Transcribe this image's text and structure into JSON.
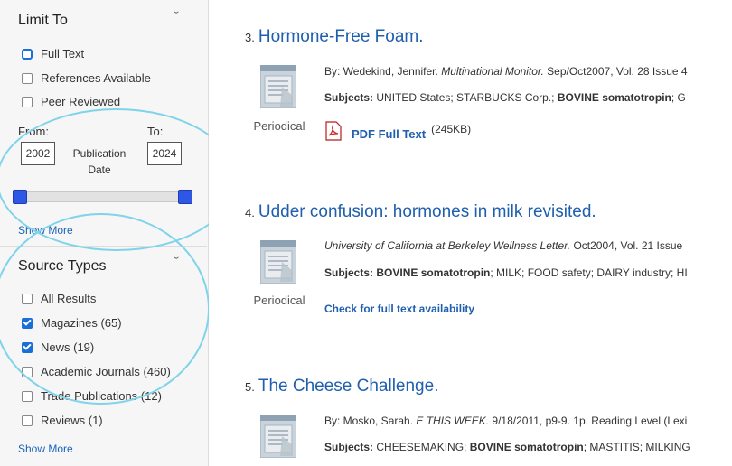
{
  "sidebar": {
    "limit_to": {
      "title": "Limit To",
      "options": [
        {
          "label": "Full Text",
          "checked": false
        },
        {
          "label": "References Available",
          "checked": false
        },
        {
          "label": "Peer Reviewed",
          "checked": false
        }
      ],
      "from_label": "From:",
      "to_label": "To:",
      "from_year": "2002",
      "to_year": "2024",
      "pub_date_label": "Publication Date",
      "show_more": "Show More"
    },
    "source_types": {
      "title": "Source Types",
      "options": [
        {
          "label": "All Results",
          "checked": false
        },
        {
          "label": "Magazines (65)",
          "checked": true
        },
        {
          "label": "News (19)",
          "checked": true
        },
        {
          "label": "Academic Journals (460)",
          "checked": false
        },
        {
          "label": "Trade Publications (12)",
          "checked": false
        },
        {
          "label": "Reviews (1)",
          "checked": false
        }
      ],
      "show_more": "Show More"
    }
  },
  "results": [
    {
      "num": "3.",
      "title": "Hormone-Free Foam.",
      "type": "Periodical",
      "meta_pre": "By: Wedekind, Jennifer.",
      "meta_italic": "Multinational Monitor.",
      "meta_post": "Sep/Oct2007, Vol. 28 Issue 4",
      "subjects_label": "Subjects:",
      "subjects_1": "UNITED States; STARBUCKS Corp.;",
      "subjects_2": "BOVINE somatotropin",
      "subjects_3": "; G",
      "pdf_link": "PDF Full Text",
      "pdf_size": "(245KB)"
    },
    {
      "num": "4.",
      "title": "Udder confusion: hormones in milk revisited.",
      "type": "Periodical",
      "meta_italic": "University of California at Berkeley Wellness Letter.",
      "meta_post": "Oct2004, Vol. 21 Issue",
      "subjects_label": "Subjects:",
      "subjects_b": "BOVINE somatotropin",
      "subjects_rest": "; MILK; FOOD safety; DAIRY industry; HI",
      "avail_link": "Check for full text availability"
    },
    {
      "num": "5.",
      "title": "The Cheese Challenge.",
      "meta_pre": "By: Mosko, Sarah.",
      "meta_italic": "E THIS WEEK.",
      "meta_post": "9/18/2011, p9-9. 1p. Reading Level (Lexi",
      "subjects_label": "Subjects:",
      "subjects_1": "CHEESEMAKING;",
      "subjects_2": "BOVINE somatotropin",
      "subjects_3": "; MASTITIS; MILKING"
    }
  ],
  "icons": {
    "chevron": "chevron-down-icon",
    "periodical": "periodical-icon",
    "pdf": "pdf-icon"
  },
  "colors": {
    "link": "#1f5fae",
    "checkbox_checked": "#1a6ed8",
    "slider_handle": "#2f57e6",
    "highlight_ring": "#7fd3ea"
  }
}
